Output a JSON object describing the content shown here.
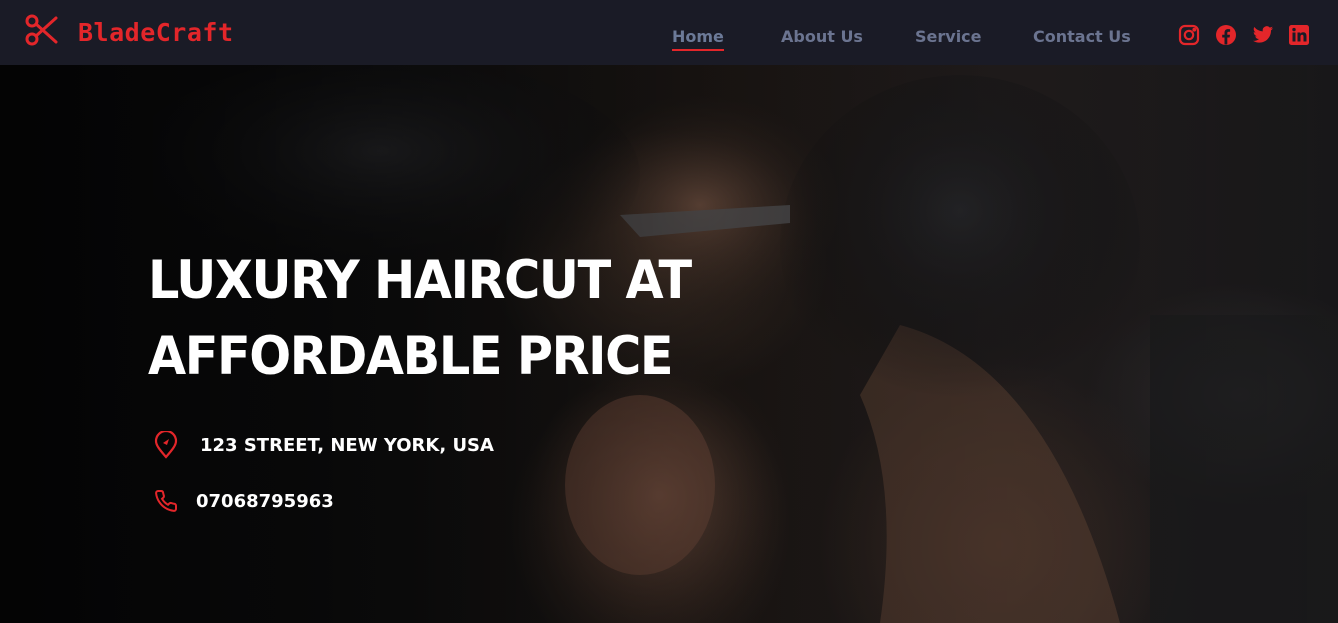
{
  "brand": {
    "name": "BladeCraft",
    "icon": "scissors-icon",
    "color": "#e3262a"
  },
  "nav": {
    "items": [
      {
        "label": "Home",
        "active": true
      },
      {
        "label": "About Us",
        "active": false
      },
      {
        "label": "Service",
        "active": false
      },
      {
        "label": "Contact Us",
        "active": false
      }
    ]
  },
  "social": [
    "instagram-icon",
    "facebook-icon",
    "twitter-icon",
    "linkedin-icon"
  ],
  "hero": {
    "title_line1": "LUXURY HAIRCUT AT",
    "title_line2": "AFFORDABLE PRICE",
    "address": "123 STREET, NEW YORK, USA",
    "address_icon": "location-pin-icon",
    "phone": "07068795963",
    "phone_icon": "phone-icon"
  },
  "colors": {
    "nav_bg": "#1a1b26",
    "accent": "#e3262a",
    "nav_text": "#6b7490"
  }
}
